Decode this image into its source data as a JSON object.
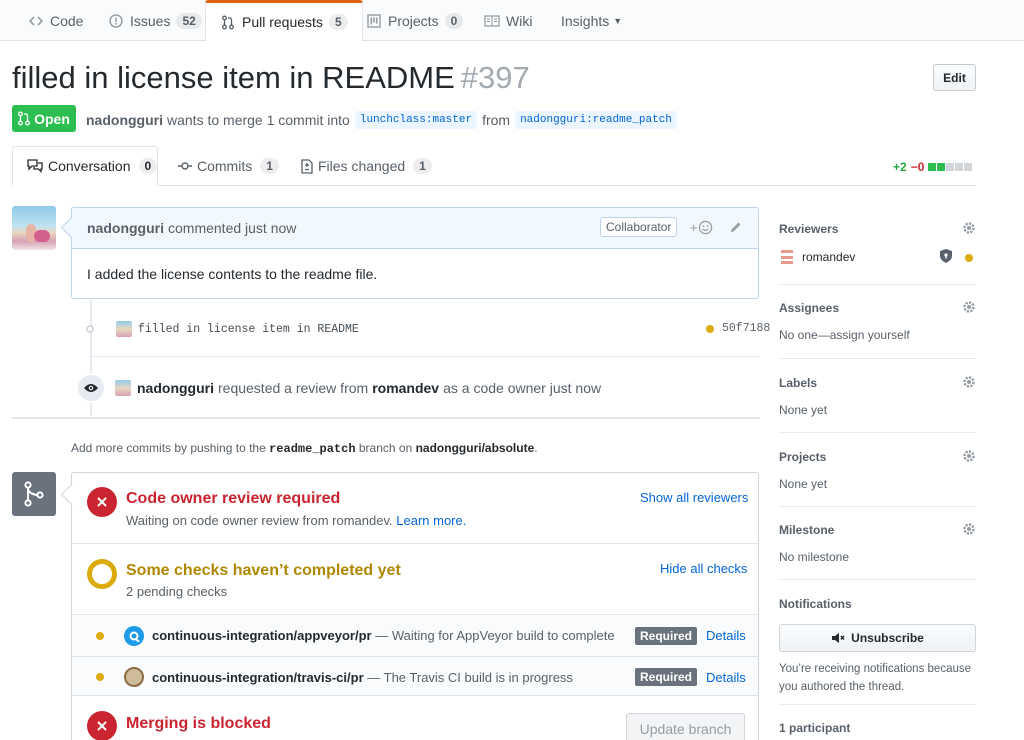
{
  "repo_nav": {
    "tabs": [
      {
        "label": "Code",
        "icon": "code-icon",
        "count": null
      },
      {
        "label": "Issues",
        "icon": "issue-icon",
        "count": "52"
      },
      {
        "label": "Pull requests",
        "icon": "pull-request-icon",
        "count": "5"
      },
      {
        "label": "Projects",
        "icon": "project-icon",
        "count": "0"
      },
      {
        "label": "Wiki",
        "icon": "book-icon",
        "count": null
      },
      {
        "label": "Insights",
        "icon": null,
        "count": null
      }
    ],
    "selected": "Pull requests"
  },
  "pr": {
    "title": "filled in license item in README",
    "number": "#397",
    "edit_label": "Edit",
    "state": "Open",
    "author": "nadongguri",
    "merge_text": "wants to merge 1 commit into",
    "base_branch": "lunchclass:master",
    "from_text": "from",
    "head_branch": "nadongguri:readme_patch"
  },
  "pr_tabs": [
    {
      "label": "Conversation",
      "count": "0",
      "icon": "conversation-icon"
    },
    {
      "label": "Commits",
      "count": "1",
      "icon": "commit-icon"
    },
    {
      "label": "Files changed",
      "count": "1",
      "icon": "file-diff-icon"
    }
  ],
  "diffstat": {
    "additions": "+2",
    "deletions": "−0"
  },
  "comment": {
    "author": "nadongguri",
    "action": "commented just now",
    "badge": "Collaborator",
    "reaction_plus": "+",
    "body": "I added the license contents to the readme file."
  },
  "commit": {
    "message": "filled in license item in README",
    "sha": "50f7188"
  },
  "review_event": {
    "actor": "nadongguri",
    "text": "requested a review from",
    "reviewer": "romandev",
    "suffix": "as a code owner just now"
  },
  "push_note": {
    "prefix": "Add more commits by pushing to the",
    "branch": "readme_patch",
    "middle": "branch on",
    "repo": "nadongguri/absolute",
    "end": "."
  },
  "merge_box": {
    "review": {
      "title": "Code owner review required",
      "subtitle": "Waiting on code owner review from romandev.",
      "learn_more": "Learn more.",
      "action": "Show all reviewers"
    },
    "checks": {
      "title": "Some checks haven’t completed yet",
      "subtitle": "2 pending checks",
      "action": "Hide all checks",
      "items": [
        {
          "name": "continuous-integration/appveyor/pr",
          "desc": "— Waiting for AppVeyor build to complete",
          "badge": "Required",
          "link": "Details",
          "logo": "appveyor-icon"
        },
        {
          "name": "continuous-integration/travis-ci/pr",
          "desc": "— The Travis CI build is in progress",
          "badge": "Required",
          "link": "Details",
          "logo": "travis-ci-icon"
        }
      ]
    },
    "merge": {
      "title": "Merging is blocked",
      "update_label": "Update branch"
    }
  },
  "sidebar": {
    "reviewers": {
      "heading": "Reviewers",
      "name": "romandev"
    },
    "assignees": {
      "heading": "Assignees",
      "value": "No one—assign yourself"
    },
    "labels": {
      "heading": "Labels",
      "value": "None yet"
    },
    "projects": {
      "heading": "Projects",
      "value": "None yet"
    },
    "milestone": {
      "heading": "Milestone",
      "value": "No milestone"
    },
    "notifications": {
      "heading": "Notifications",
      "button": "Unsubscribe",
      "note": "You’re receiving notifications because you authored the thread."
    },
    "participants": {
      "heading": "1 participant"
    }
  },
  "colors": {
    "open_green": "#2cbe4e",
    "link_blue": "#0366d6",
    "error_red": "#cb2431",
    "pending_yellow": "#dbab09",
    "tab_accent": "#e36209"
  }
}
